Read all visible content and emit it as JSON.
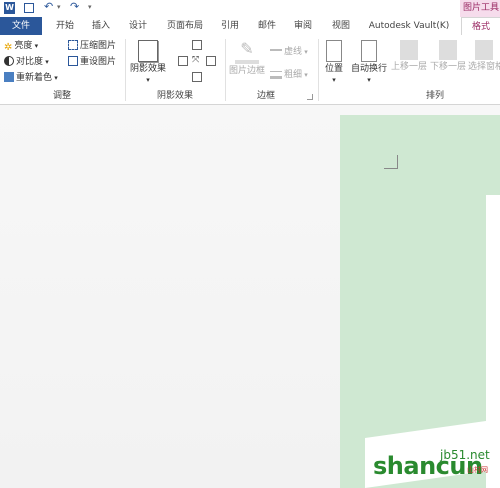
{
  "title_bar": {
    "context_label": "图片工具"
  },
  "tabs": [
    {
      "label": "文件"
    },
    {
      "label": "开始"
    },
    {
      "label": "插入"
    },
    {
      "label": "设计"
    },
    {
      "label": "页面布局"
    },
    {
      "label": "引用"
    },
    {
      "label": "邮件"
    },
    {
      "label": "审阅"
    },
    {
      "label": "视图"
    },
    {
      "label": "Autodesk Vault(K)"
    },
    {
      "label": "格式"
    }
  ],
  "ribbon": {
    "adjust": {
      "brightness": "亮度",
      "contrast": "对比度",
      "recolor": "重新着色",
      "compress": "压缩图片",
      "reset": "重设图片",
      "group_label": "调整"
    },
    "shadow": {
      "shadow_effects": "阴影效果",
      "group_label": "阴影效果"
    },
    "border": {
      "picture_border": "图片边框",
      "dashes": "虚线",
      "weight": "粗细",
      "group_label": "边框"
    },
    "arrange": {
      "position": "位置",
      "wrap_text": "自动换行",
      "bring_forward": "上移一层",
      "send_backward": "下移一层",
      "selection_pane": "选择窗格",
      "group_label": "排列"
    }
  },
  "watermark": {
    "brand": "shancun",
    "site": "jb51.net",
    "cn": "山村网"
  },
  "colors": {
    "file_tab": "#2b579a",
    "context_tab": "#9a2a64",
    "page": "#cfe8d2"
  }
}
